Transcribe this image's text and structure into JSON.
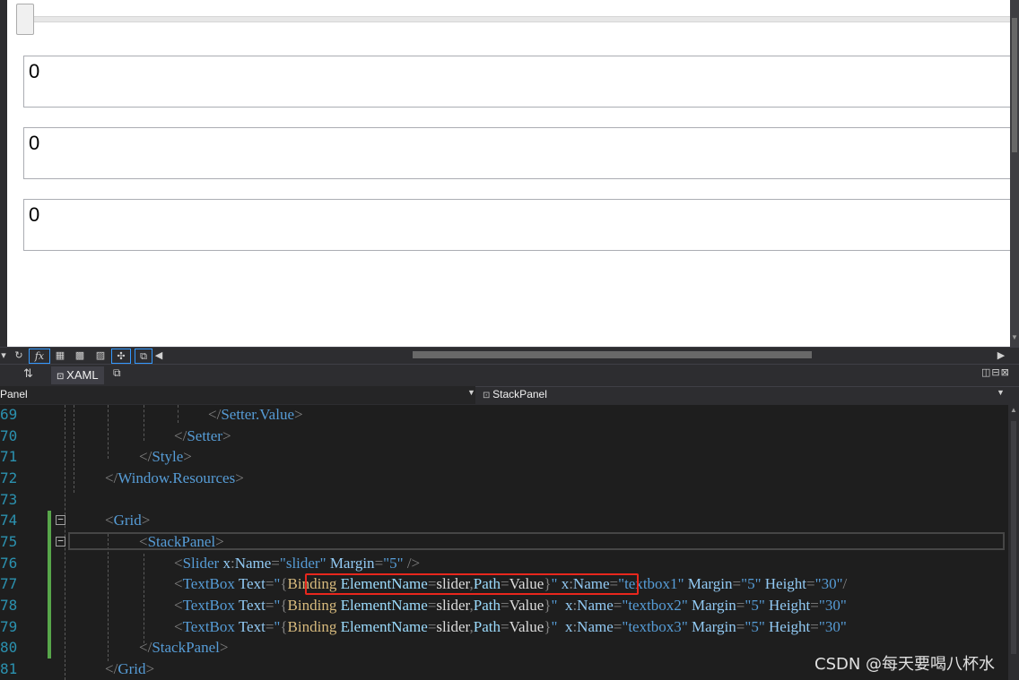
{
  "designer": {
    "textboxes": [
      {
        "value": "0"
      },
      {
        "value": "0"
      },
      {
        "value": "0"
      }
    ]
  },
  "designer_toolbar": {
    "fx_label": "fx"
  },
  "tabbar": {
    "tab_label": "XAML"
  },
  "navbar": {
    "left_label": "Panel",
    "right_label": "StackPanel"
  },
  "editor": {
    "lines": [
      {
        "num": "69",
        "tokens": [
          [
            "b",
            "</"
          ],
          [
            "e",
            "Setter.Value"
          ],
          [
            "b",
            ">"
          ]
        ]
      },
      {
        "num": "70",
        "tokens": [
          [
            "b",
            "</"
          ],
          [
            "e",
            "Setter"
          ],
          [
            "b",
            ">"
          ]
        ]
      },
      {
        "num": "71",
        "tokens": [
          [
            "b",
            "</"
          ],
          [
            "e",
            "Style"
          ],
          [
            "b",
            ">"
          ]
        ]
      },
      {
        "num": "72",
        "tokens": [
          [
            "b",
            "</"
          ],
          [
            "e",
            "Window.Resources"
          ],
          [
            "b",
            ">"
          ]
        ]
      },
      {
        "num": "73",
        "tokens": []
      },
      {
        "num": "74",
        "tokens": [
          [
            "b",
            "<"
          ],
          [
            "e",
            "Grid"
          ],
          [
            "b",
            ">"
          ]
        ]
      },
      {
        "num": "75",
        "tokens": [
          [
            "b",
            "<"
          ],
          [
            "e",
            "StackPanel"
          ],
          [
            "b",
            ">"
          ]
        ]
      },
      {
        "num": "76",
        "tokens": [
          [
            "b",
            "<"
          ],
          [
            "e",
            "Slider "
          ],
          [
            "a",
            "x"
          ],
          [
            "b",
            ":"
          ],
          [
            "a",
            "Name"
          ],
          [
            "b",
            "="
          ],
          [
            "q",
            "\""
          ],
          [
            "v",
            "slider"
          ],
          [
            "q",
            "\""
          ],
          [
            "a",
            " Margin"
          ],
          [
            "b",
            "="
          ],
          [
            "q",
            "\""
          ],
          [
            "v",
            "5"
          ],
          [
            "q",
            "\""
          ],
          [
            "b",
            " />"
          ]
        ]
      },
      {
        "num": "77",
        "tokens": [
          [
            "b",
            "<"
          ],
          [
            "e",
            "TextBox "
          ],
          [
            "a",
            "Text"
          ],
          [
            "b",
            "="
          ],
          [
            "q",
            "\""
          ],
          [
            "b",
            "{"
          ],
          [
            "m",
            "Binding "
          ],
          [
            "k",
            "ElementName"
          ],
          [
            "b",
            "="
          ],
          [
            "t",
            "slider"
          ],
          [
            "b",
            ","
          ],
          [
            "k",
            "Path"
          ],
          [
            "b",
            "="
          ],
          [
            "t",
            "Value"
          ],
          [
            "b",
            "}"
          ],
          [
            "q",
            "\""
          ],
          [
            "a",
            " x"
          ],
          [
            "b",
            ":"
          ],
          [
            "a",
            "Name"
          ],
          [
            "b",
            "="
          ],
          [
            "q",
            "\""
          ],
          [
            "v",
            "textbox1"
          ],
          [
            "q",
            "\""
          ],
          [
            "a",
            " Margin"
          ],
          [
            "b",
            "="
          ],
          [
            "q",
            "\""
          ],
          [
            "v",
            "5"
          ],
          [
            "q",
            "\""
          ],
          [
            "a",
            " Height"
          ],
          [
            "b",
            "="
          ],
          [
            "q",
            "\""
          ],
          [
            "v",
            "30"
          ],
          [
            "q",
            "\""
          ],
          [
            "b",
            "/"
          ]
        ]
      },
      {
        "num": "78",
        "tokens": [
          [
            "b",
            "<"
          ],
          [
            "e",
            "TextBox "
          ],
          [
            "a",
            "Text"
          ],
          [
            "b",
            "="
          ],
          [
            "q",
            "\""
          ],
          [
            "b",
            "{"
          ],
          [
            "m",
            "Binding "
          ],
          [
            "k",
            "ElementName"
          ],
          [
            "b",
            "="
          ],
          [
            "t",
            "slider"
          ],
          [
            "b",
            ","
          ],
          [
            "k",
            "Path"
          ],
          [
            "b",
            "="
          ],
          [
            "t",
            "Value"
          ],
          [
            "b",
            "}"
          ],
          [
            "q",
            "\""
          ],
          [
            "a",
            "  x"
          ],
          [
            "b",
            ":"
          ],
          [
            "a",
            "Name"
          ],
          [
            "b",
            "="
          ],
          [
            "q",
            "\""
          ],
          [
            "v",
            "textbox2"
          ],
          [
            "q",
            "\""
          ],
          [
            "a",
            " Margin"
          ],
          [
            "b",
            "="
          ],
          [
            "q",
            "\""
          ],
          [
            "v",
            "5"
          ],
          [
            "q",
            "\""
          ],
          [
            "a",
            " Height"
          ],
          [
            "b",
            "="
          ],
          [
            "q",
            "\""
          ],
          [
            "v",
            "30"
          ],
          [
            "q",
            "\""
          ]
        ]
      },
      {
        "num": "79",
        "tokens": [
          [
            "b",
            "<"
          ],
          [
            "e",
            "TextBox "
          ],
          [
            "a",
            "Text"
          ],
          [
            "b",
            "="
          ],
          [
            "q",
            "\""
          ],
          [
            "b",
            "{"
          ],
          [
            "m",
            "Binding "
          ],
          [
            "k",
            "ElementName"
          ],
          [
            "b",
            "="
          ],
          [
            "t",
            "slider"
          ],
          [
            "b",
            ","
          ],
          [
            "k",
            "Path"
          ],
          [
            "b",
            "="
          ],
          [
            "t",
            "Value"
          ],
          [
            "b",
            "}"
          ],
          [
            "q",
            "\""
          ],
          [
            "a",
            "  x"
          ],
          [
            "b",
            ":"
          ],
          [
            "a",
            "Name"
          ],
          [
            "b",
            "="
          ],
          [
            "q",
            "\""
          ],
          [
            "v",
            "textbox3"
          ],
          [
            "q",
            "\""
          ],
          [
            "a",
            " Margin"
          ],
          [
            "b",
            "="
          ],
          [
            "q",
            "\""
          ],
          [
            "v",
            "5"
          ],
          [
            "q",
            "\""
          ],
          [
            "a",
            " Height"
          ],
          [
            "b",
            "="
          ],
          [
            "q",
            "\""
          ],
          [
            "v",
            "30"
          ],
          [
            "q",
            "\""
          ]
        ]
      },
      {
        "num": "80",
        "tokens": [
          [
            "b",
            "</"
          ],
          [
            "e",
            "StackPanel"
          ],
          [
            "b",
            ">"
          ]
        ]
      },
      {
        "num": "81",
        "tokens": [
          [
            "b",
            "</"
          ],
          [
            "e",
            "Grid"
          ],
          [
            "b",
            ">"
          ]
        ]
      }
    ]
  },
  "watermark": "CSDN @每天要喝八杯水"
}
